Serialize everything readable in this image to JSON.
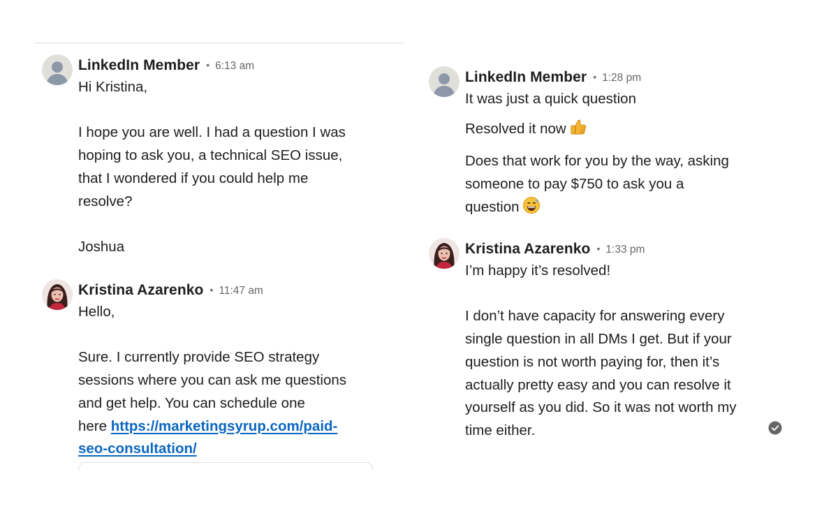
{
  "left_panel": {
    "messages": [
      {
        "sender": "LinkedIn Member",
        "time": "6:13 am",
        "lines": [
          "Hi Kristina,",
          "",
          "I hope you are well. I had a question I was",
          "hoping to ask you, a technical SEO issue,",
          "that I wondered if you could help me",
          "resolve?",
          "",
          "Joshua"
        ]
      },
      {
        "sender": "Kristina Azarenko",
        "time": "11:47 am",
        "lines": [
          "Hello,",
          "",
          "Sure. I currently provide SEO strategy",
          "sessions where you can ask me questions",
          "and get help. You can schedule one"
        ],
        "link_prefix": "here ",
        "link_line1": "https://marketingsyrup.com/paid-",
        "link_line2": "seo-consultation/"
      }
    ]
  },
  "right_panel": {
    "messages": [
      {
        "sender": "LinkedIn Member",
        "time": "1:28 pm",
        "line1": "It was just a quick question",
        "line2": "Resolved it now",
        "line2_emoji": "thumbs-up-emoji",
        "line3a": "Does that work for you by the way, asking",
        "line3b": "someone to pay $750 to ask you a",
        "line3c": "question",
        "line3_emoji": "grinning-sweat-emoji"
      },
      {
        "sender": "Kristina Azarenko",
        "time": "1:33 pm",
        "lines": [
          "I’m happy it’s resolved!",
          "",
          "I don’t have capacity for answering every",
          "single question in all DMs I get. But if your",
          "question is not worth paying for, then it’s",
          "actually pretty easy and you can resolve it",
          "yourself as you did. So it was not worth my",
          "time either."
        ]
      }
    ],
    "read_receipt_icon": "check-circle-icon"
  },
  "colors": {
    "link": "#0a66c2",
    "text": "#1d1d1d",
    "meta": "#666666",
    "divider": "#dcdcdc"
  }
}
